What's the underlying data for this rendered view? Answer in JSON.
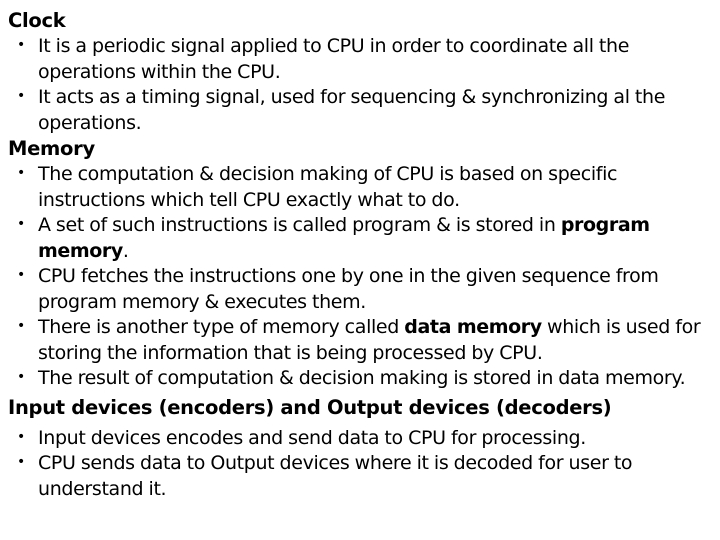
{
  "document": {
    "background_color": "#ffffff",
    "text_color": "#000000",
    "sections": [
      {
        "id": "clock",
        "heading": "Clock",
        "bullets": [
          {
            "parts": [
              {
                "text": "It is a periodic signal applied to CPU in order to coordinate all the operations within the CPU.",
                "bold": false
              }
            ]
          },
          {
            "parts": [
              {
                "text": "It acts as a timing signal, used for sequencing & synchronizing al the operations.",
                "bold": false
              }
            ]
          }
        ]
      },
      {
        "id": "memory",
        "heading": "Memory",
        "bullets": [
          {
            "parts": [
              {
                "text": "The computation & decision making of CPU is based on specific instructions which tell CPU exactly what to do.",
                "bold": false
              }
            ]
          },
          {
            "parts": [
              {
                "text": "A set of such instructions is called program & is stored in ",
                "bold": false
              },
              {
                "text": "program memory",
                "bold": true
              },
              {
                "text": ".",
                "bold": false
              }
            ]
          },
          {
            "parts": [
              {
                "text": "CPU fetches the instructions one by one in the given sequence from program memory & executes them.",
                "bold": false
              }
            ]
          },
          {
            "parts": [
              {
                "text": "There is another type of memory called ",
                "bold": false
              },
              {
                "text": "data memory",
                "bold": true
              },
              {
                "text": " which is used for storing the information that is being processed by CPU.",
                "bold": false
              }
            ]
          },
          {
            "parts": [
              {
                "text": "The result of computation & decision making is stored in data memory.",
                "bold": false
              }
            ]
          }
        ]
      },
      {
        "id": "io-devices",
        "heading": "Input devices (encoders) and Output devices (decoders)",
        "heading_extra_gap": true,
        "bullets": [
          {
            "parts": [
              {
                "text": "Input devices encodes and send data to CPU for processing.",
                "bold": false
              }
            ]
          },
          {
            "parts": [
              {
                "text": "CPU sends data to Output devices where it is decoded for user to understand it.",
                "bold": false
              }
            ]
          }
        ]
      }
    ]
  }
}
